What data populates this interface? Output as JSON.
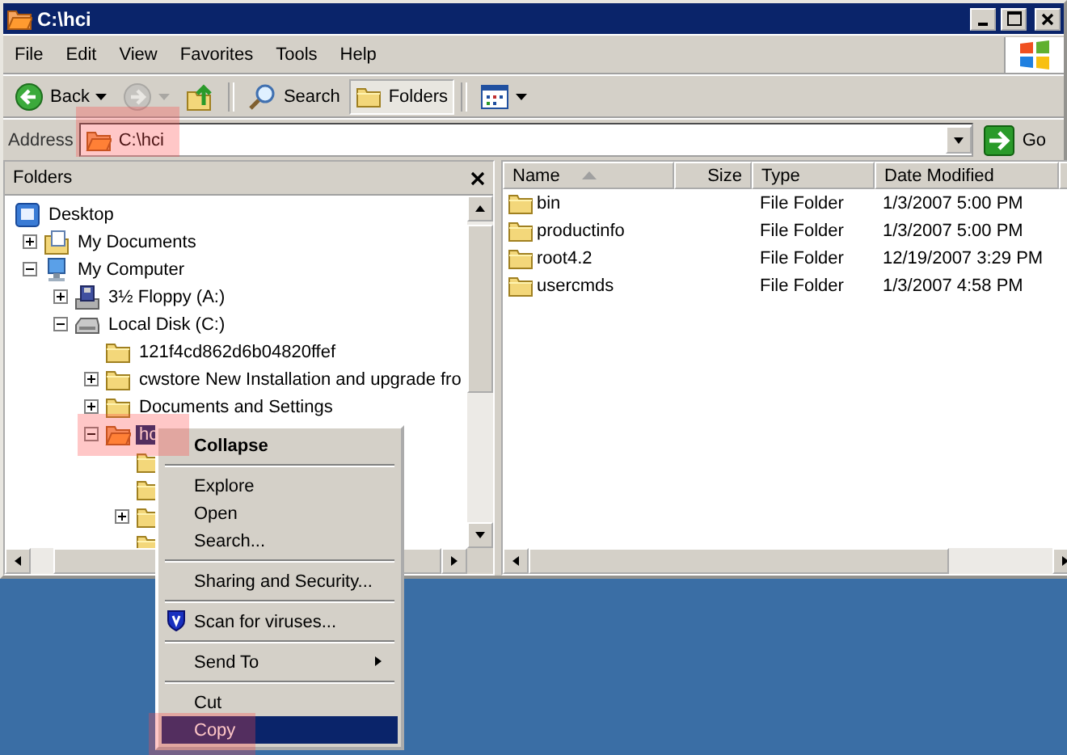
{
  "window": {
    "title": "C:\\hci"
  },
  "menu": [
    "File",
    "Edit",
    "View",
    "Favorites",
    "Tools",
    "Help"
  ],
  "toolbar": [
    {
      "kind": "back",
      "label": "Back",
      "disabled": false
    },
    {
      "kind": "forward",
      "disabled": true
    },
    {
      "kind": "up"
    },
    {
      "kind": "search",
      "label": "Search"
    },
    {
      "kind": "folders",
      "label": "Folders",
      "selected": true
    },
    {
      "kind": "views"
    }
  ],
  "address": {
    "label": "Address",
    "value": "C:\\hci",
    "go": "Go"
  },
  "folders_pane": {
    "title": "Folders",
    "tree": [
      {
        "label": "Desktop",
        "kind": "desktop",
        "selected": false,
        "children": [
          {
            "label": "My Documents",
            "kind": "documents",
            "expanded": false,
            "selected": false
          },
          {
            "label": "My Computer",
            "kind": "computer",
            "expanded": true,
            "selected": false,
            "children": [
              {
                "label": "3½ Floppy (A:)",
                "kind": "floppy",
                "expanded": false,
                "selected": false
              },
              {
                "label": "Local Disk (C:)",
                "kind": "disk",
                "expanded": true,
                "selected": false,
                "children": [
                  {
                    "label": "121f4cd862d6b04820ffef",
                    "kind": "folder",
                    "selected": false
                  },
                  {
                    "label": "cwstore New Installation and upgrade fro",
                    "kind": "folder",
                    "expanded": false,
                    "selected": false
                  },
                  {
                    "label": "Documents and Settings",
                    "kind": "folder",
                    "expanded": false,
                    "selected": false
                  },
                  {
                    "label": "hc",
                    "kind": "open-folder",
                    "expanded": true,
                    "selected": true,
                    "children": [
                      {
                        "kind": "folder"
                      },
                      {
                        "kind": "folder"
                      },
                      {
                        "kind": "folder",
                        "expanded": false
                      },
                      {
                        "kind": "folder"
                      }
                    ]
                  }
                ]
              }
            ]
          }
        ]
      }
    ]
  },
  "list": {
    "columns": [
      {
        "label": "Name",
        "sorted": true
      },
      {
        "label": "Size",
        "sorted": false
      },
      {
        "label": "Type",
        "sorted": false
      },
      {
        "label": "Date Modified",
        "sorted": false
      }
    ],
    "rows": [
      {
        "name": "bin",
        "type": "File Folder",
        "date": "1/3/2007 5:00 PM"
      },
      {
        "name": "productinfo",
        "type": "File Folder",
        "date": "1/3/2007 5:00 PM"
      },
      {
        "name": "root4.2",
        "type": "File Folder",
        "date": "12/19/2007 3:29 PM"
      },
      {
        "name": "usercmds",
        "type": "File Folder",
        "date": "1/3/2007 4:58 PM"
      }
    ]
  },
  "context_menu": {
    "items": [
      {
        "kind": "default",
        "label": "Collapse",
        "selected": false
      },
      {
        "kind": "separator"
      },
      {
        "kind": "item",
        "label": "Explore",
        "selected": false
      },
      {
        "kind": "item",
        "label": "Open",
        "selected": false
      },
      {
        "kind": "item",
        "label": "Search...",
        "selected": false
      },
      {
        "kind": "separator"
      },
      {
        "kind": "item",
        "label": "Sharing and Security...",
        "selected": false
      },
      {
        "kind": "separator"
      },
      {
        "kind": "scan",
        "label": "Scan for viruses...",
        "selected": false
      },
      {
        "kind": "separator"
      },
      {
        "kind": "submenu",
        "label": "Send To",
        "selected": false
      },
      {
        "kind": "separator"
      },
      {
        "kind": "item",
        "label": "Cut",
        "selected": false
      },
      {
        "kind": "item",
        "label": "Copy",
        "selected": true
      }
    ]
  }
}
